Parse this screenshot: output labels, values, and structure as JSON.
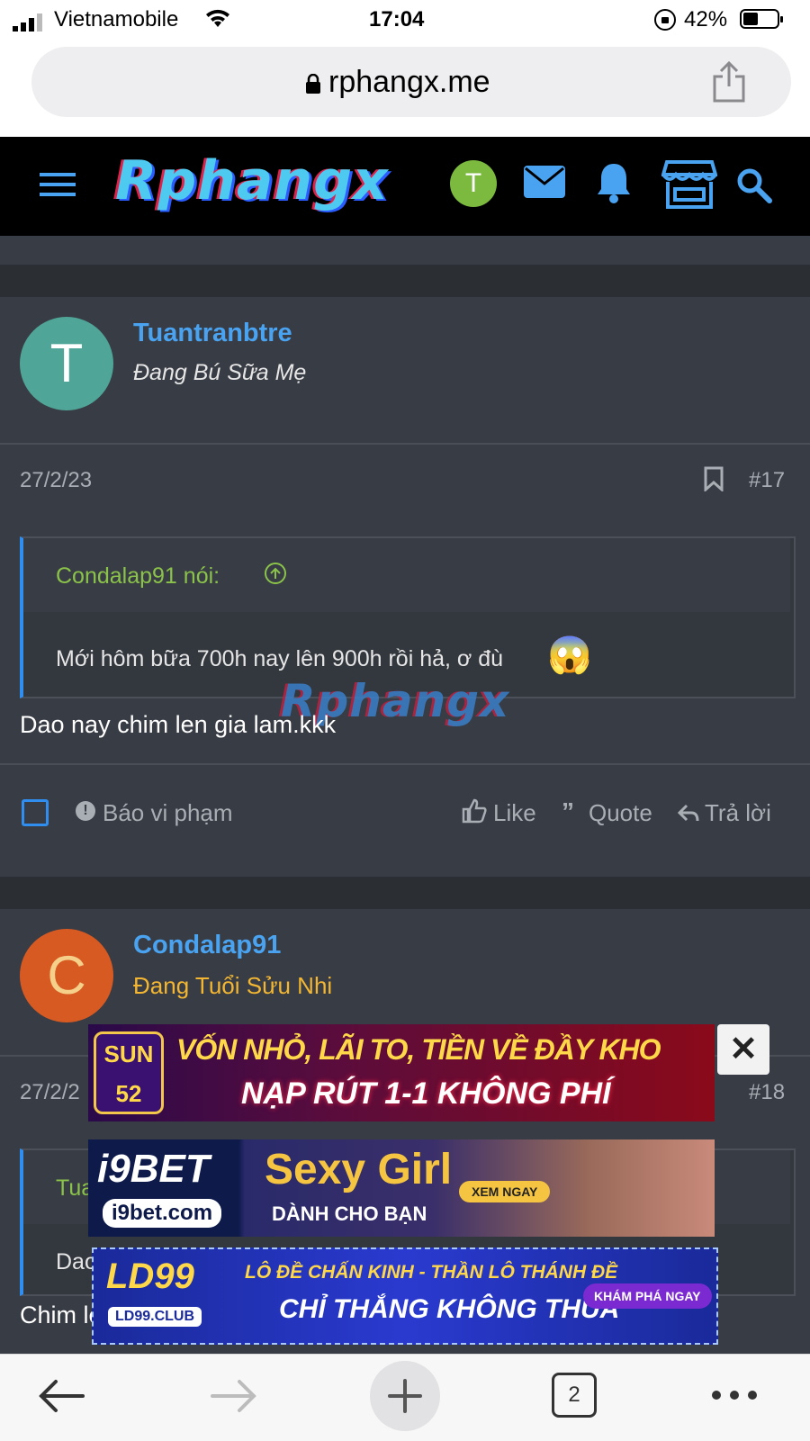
{
  "status": {
    "carrier": "Vietnamobile",
    "time": "17:04",
    "battery": "42%"
  },
  "browser": {
    "url": "rphangx.me",
    "tab_count": "2"
  },
  "site": {
    "logo": "Rphangx",
    "user_initial": "T",
    "watermark": "Rphangx"
  },
  "posts": [
    {
      "avatar_initial": "T",
      "avatar_color": "#4fa597",
      "username": "Tuantranbtre",
      "user_title": "Đang Bú Sữa Mẹ",
      "date": "27/2/23",
      "post_number": "#17",
      "quote_author": "Condalap91 nói:",
      "quote_text": "Mới hôm bữa 700h nay lên 900h rồi hả, ơ đù",
      "quote_emoji": "😱",
      "body": "Dao nay chim len gia lam.kkk",
      "actions": {
        "report": "Báo vi phạm",
        "like": "Like",
        "quote": "Quote",
        "reply": "Trả lời"
      }
    },
    {
      "avatar_initial": "C",
      "avatar_color": "#d85a23",
      "username": "Condalap91",
      "user_title": "Đang Tuổi Sửu Nhi",
      "date": "27/2/2",
      "post_number": "#18",
      "quote_author_partial": "Tua",
      "quote_text_partial": "Dao",
      "body": "Chim len qua chac treo ra luon kkk"
    }
  ],
  "ads": [
    {
      "brand": "SUN 52",
      "line1": "VỐN NHỎ, LÃI TO, TIỀN VỀ ĐẦY KHO",
      "line2": "NẠP RÚT 1-1 KHÔNG PHÍ"
    },
    {
      "brand": "i9BET",
      "domain": "i9bet.com",
      "line1": "Sexy Girl",
      "line2": "DÀNH CHO BẠN",
      "cta": "XEM NGAY"
    },
    {
      "brand": "LD99",
      "domain": "LD99.CLUB",
      "line1": "LÔ ĐỀ CHẤN KINH - THẦN LÔ THÁNH ĐỀ",
      "line2": "CHỈ THẮNG KHÔNG THUA",
      "cta": "KHÁM PHÁ NGAY"
    }
  ],
  "ad_close": "✕",
  "colors": {
    "link": "#4aa3f0",
    "quote_author": "#8bc34a",
    "title_gold": "#f2b632",
    "accent_blue": "#2f8ef0"
  }
}
